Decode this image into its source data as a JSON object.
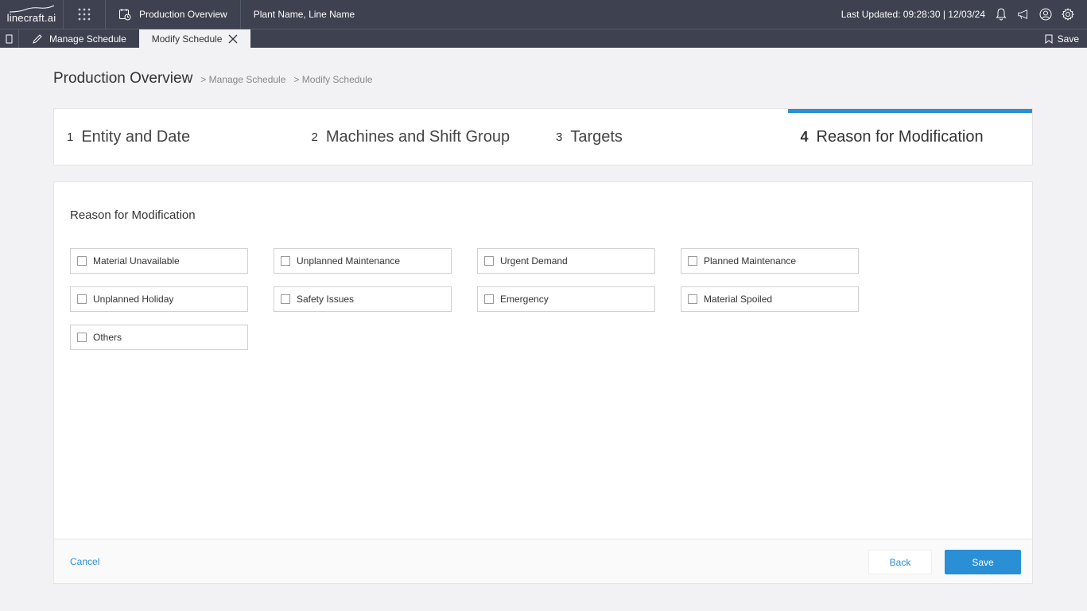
{
  "header": {
    "logo_text": "linecraft.ai",
    "module_title": "Production Overview",
    "plant_line": "Plant Name, Line Name",
    "last_updated": "Last Updated: 09:28:30 | 12/03/24"
  },
  "tabs": {
    "items": [
      {
        "label": "Manage Schedule",
        "icon": "pencil-icon"
      },
      {
        "label": "Modify Schedule",
        "icon": "close-icon"
      }
    ],
    "save_label": "Save"
  },
  "breadcrumb": {
    "title": "Production Overview",
    "items": [
      "> Manage Schedule",
      "> Modify Schedule"
    ]
  },
  "stepper": {
    "steps": [
      {
        "num": "1",
        "label": "Entity and Date"
      },
      {
        "num": "2",
        "label": "Machines and Shift Group"
      },
      {
        "num": "3",
        "label": "Targets"
      },
      {
        "num": "4",
        "label": "Reason for Modification"
      }
    ],
    "active_step": 4,
    "accent_color": "#2b8fd6"
  },
  "form": {
    "title": "Reason for Modification",
    "options": [
      {
        "label": "Material Unavailable",
        "checked": false
      },
      {
        "label": "Unplanned Maintenance",
        "checked": false
      },
      {
        "label": "Urgent Demand",
        "checked": false
      },
      {
        "label": "Planned Maintenance",
        "checked": false
      },
      {
        "label": "Unplanned Holiday",
        "checked": false
      },
      {
        "label": "Safety Issues",
        "checked": false
      },
      {
        "label": "Emergency",
        "checked": false
      },
      {
        "label": "Material Spoiled",
        "checked": false
      },
      {
        "label": "Others",
        "checked": false
      }
    ]
  },
  "footer": {
    "cancel_label": "Cancel",
    "back_label": "Back",
    "save_label": "Save"
  }
}
